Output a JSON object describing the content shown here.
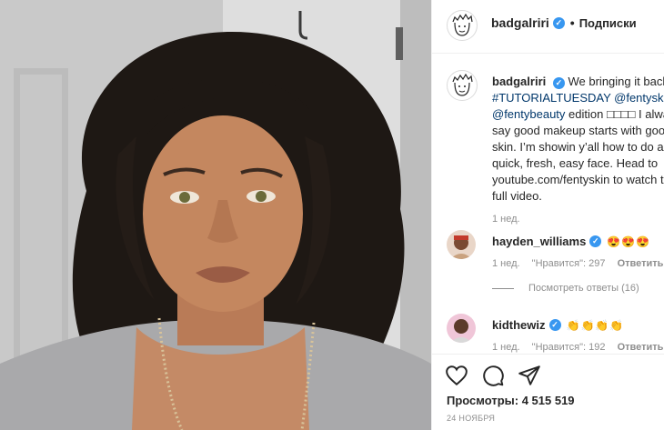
{
  "post": {
    "header": {
      "username": "badgalriri",
      "verified_mark": "✓",
      "separator": "•",
      "follow_label": "Подписки"
    },
    "caption": {
      "username": "badgalriri",
      "text_1": "We bringing it back",
      "hashtag": "#TUTORIALTUESDAY",
      "mention_1": "@fentyskin",
      "mention_2": "@fentybeauty",
      "text_2": "edition □□□□ I always say good makeup starts with good skin. I’m showin y’all how to do a quick, fresh, easy face. Head to",
      "link": "youtube.com/fentyskin",
      "text_3": "to watch the full video.",
      "age": "1 нед."
    },
    "comments": [
      {
        "username": "hayden_williams",
        "emoji": "😍😍😍",
        "age": "1 нед.",
        "likes": "\"Нравится\": 297",
        "reply_label": "Ответить"
      },
      {
        "username": "kidthewiz",
        "emoji": "👏👏👏👏",
        "age": "1 нед.",
        "likes": "\"Нравится\": 192",
        "reply_label": "Ответить"
      }
    ],
    "view_replies": "Посмотреть ответы (16)",
    "views_label": "Просмотры: 4 515 519",
    "date": "24 НОЯБРЯ",
    "icons": {
      "like": "heart-icon",
      "comment": "comment-icon",
      "share": "share-icon",
      "save": "bookmark-icon"
    },
    "colors": {
      "verified": "#3897f0",
      "link": "#00376b",
      "secondary_text": "#8e8e8e"
    }
  }
}
